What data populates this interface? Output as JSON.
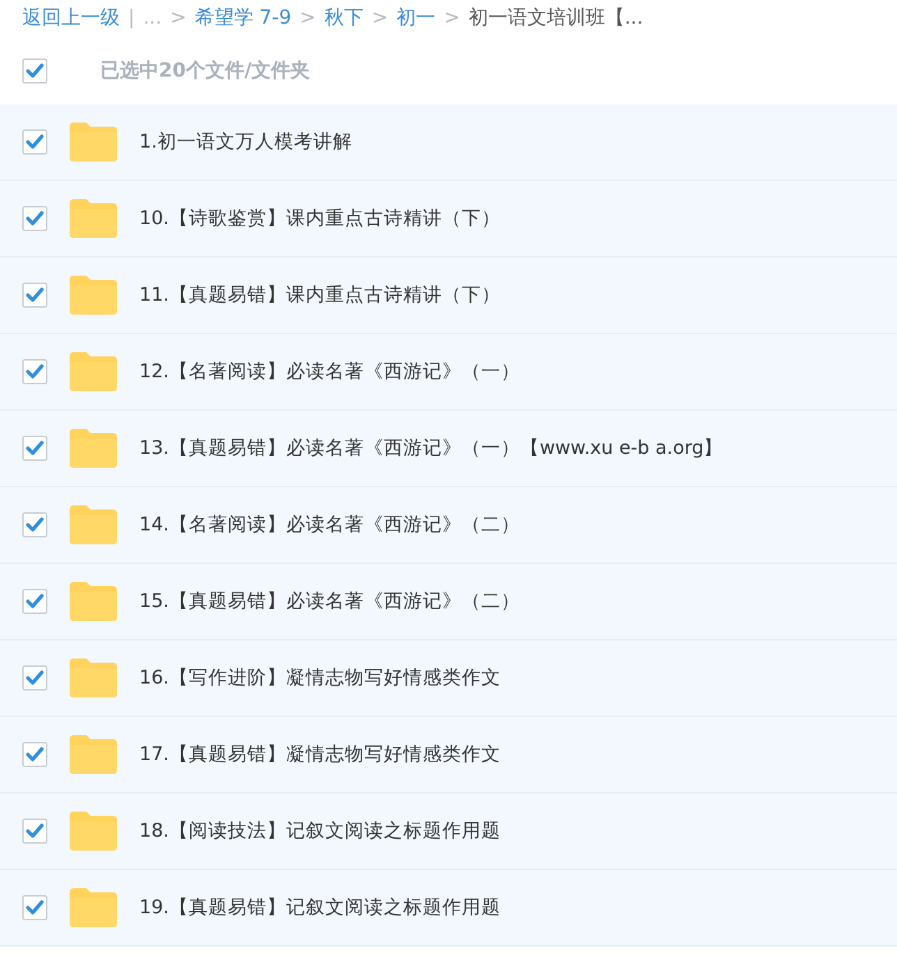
{
  "breadcrumb": {
    "back": "返回上一级",
    "divider": "|",
    "crumbs": [
      {
        "label": "...",
        "kind": "ellipsis",
        "separator": ">"
      },
      {
        "label": "希望学 7-9",
        "kind": "link",
        "separator": ">"
      },
      {
        "label": "秋下",
        "kind": "link",
        "separator": ">"
      },
      {
        "label": "初一",
        "kind": "link",
        "separator": ">"
      },
      {
        "label": "初一语文培训班【...",
        "kind": "current"
      }
    ]
  },
  "header": {
    "checked": true,
    "text": "已选中20个文件/文件夹"
  },
  "rows": [
    {
      "name": "1.初一语文万人模考讲解",
      "checked": true,
      "selected": true
    },
    {
      "name": "10.【诗歌鉴赏】课内重点古诗精讲（下）",
      "checked": true,
      "selected": true
    },
    {
      "name": "11.【真题易错】课内重点古诗精讲（下）",
      "checked": true,
      "selected": true
    },
    {
      "name": "12.【名著阅读】必读名著《西游记》（一）",
      "checked": true,
      "selected": true
    },
    {
      "name": "13.【真题易错】必读名著《西游记》（一）【www.xu e-b a.org】",
      "checked": true,
      "selected": true
    },
    {
      "name": "14.【名著阅读】必读名著《西游记》（二）",
      "checked": true,
      "selected": true
    },
    {
      "name": "15.【真题易错】必读名著《西游记》（二）",
      "checked": true,
      "selected": true
    },
    {
      "name": "16.【写作进阶】凝情志物写好情感类作文",
      "checked": true,
      "selected": true
    },
    {
      "name": "17.【真题易错】凝情志物写好情感类作文",
      "checked": true,
      "selected": true
    },
    {
      "name": "18.【阅读技法】记叙文阅读之标题作用题",
      "checked": true,
      "selected": true
    },
    {
      "name": "19.【真题易错】记叙文阅读之标题作用题",
      "checked": true,
      "selected": true
    }
  ]
}
